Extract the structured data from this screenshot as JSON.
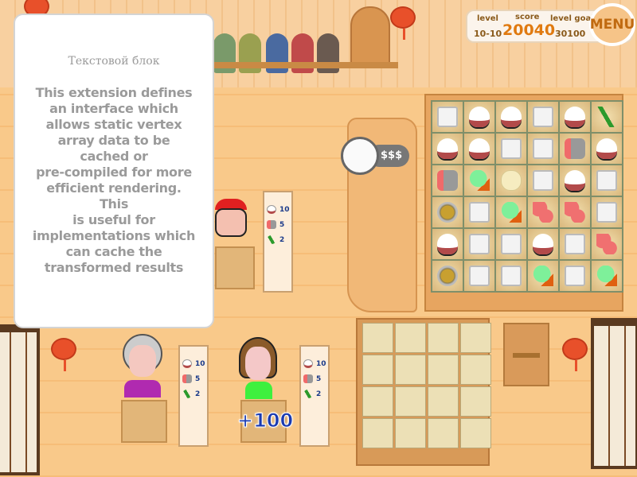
{
  "hud": {
    "level_label": "level",
    "level_value": "10-10",
    "score_label": "score",
    "score_value": "20040",
    "goal_label": "level goal",
    "goal_value": "30100",
    "menu_label": "MENU"
  },
  "text_block": {
    "title": "Текстовой блок",
    "body": "This extension defines\nan interface which\nallows static vertex\narray data to be\ncached or\npre-compiled for more\nefficient rendering.\nThis\n  is useful for\nimplementations which\ncan cache the\ntransformed results"
  },
  "price_tag": "$$$",
  "board": {
    "rows": [
      [
        "tofu",
        "rice",
        "rice",
        "tofu",
        "rice",
        "seaweed"
      ],
      [
        "rice",
        "rice",
        "tofu",
        "tofu",
        "salmon",
        "rice"
      ],
      [
        "salmon",
        "veg",
        "ginger",
        "tofu",
        "rice",
        "tofu"
      ],
      [
        "soup",
        "tofu",
        "veg",
        "shrimp",
        "shrimp",
        "tofu"
      ],
      [
        "rice",
        "tofu",
        "tofu",
        "rice",
        "tofu",
        "shrimp"
      ],
      [
        "soup",
        "tofu",
        "tofu",
        "veg",
        "tofu",
        "veg"
      ]
    ]
  },
  "orders": [
    {
      "customer": "red-cap-boy",
      "items": [
        {
          "icon": "rice",
          "qty": "10"
        },
        {
          "icon": "salmon",
          "qty": "5"
        },
        {
          "icon": "seaweed",
          "qty": "2"
        }
      ]
    },
    {
      "customer": "grandma",
      "items": [
        {
          "icon": "rice",
          "qty": "10"
        },
        {
          "icon": "salmon",
          "qty": "5"
        },
        {
          "icon": "seaweed",
          "qty": "2"
        }
      ]
    },
    {
      "customer": "girl-glasses",
      "items": [
        {
          "icon": "rice",
          "qty": "10"
        },
        {
          "icon": "salmon",
          "qty": "5"
        },
        {
          "icon": "seaweed",
          "qty": "2"
        }
      ]
    }
  ],
  "bonus_popup": "+100",
  "colors": {
    "accent": "#e07a10",
    "wall": "#f9c98a",
    "text_gray": "#9a9a9a",
    "popup_blue": "#1a3ab0"
  }
}
